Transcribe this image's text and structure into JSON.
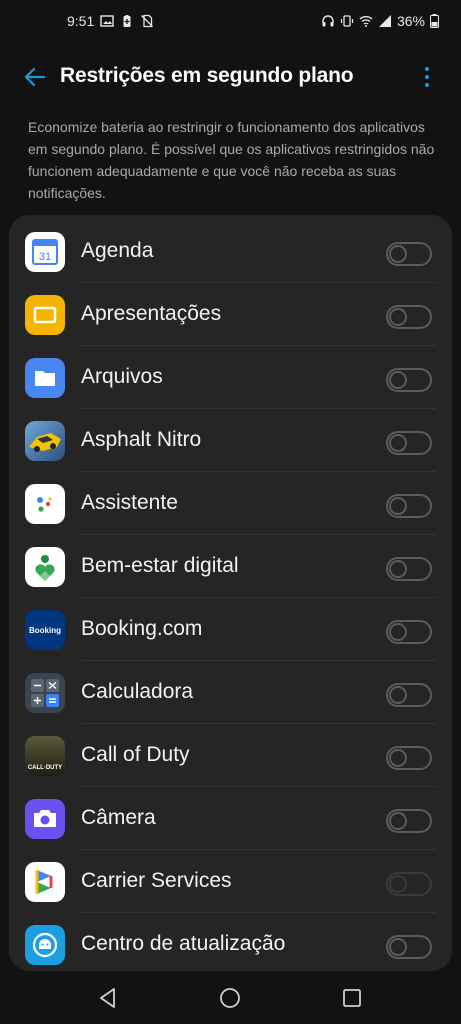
{
  "status_bar": {
    "time": "9:51",
    "battery_percent": "36%",
    "left_icons": [
      "gallery-icon",
      "battery-saver-icon",
      "no-sim-icon"
    ],
    "right_icons": [
      "headset-icon",
      "vibrate-icon",
      "wifi-icon",
      "signal-icon",
      "battery-icon"
    ]
  },
  "header": {
    "title": "Restrições em segundo plano",
    "back_icon": "arrow-back-icon",
    "menu_icon": "more-vert-icon",
    "accent_color": "#1a9bd6"
  },
  "description": "Economize bateria ao restringir o funcionamento dos aplicativos em segundo plano. É possível que os aplicativos restringidos não funcionem adequadamente e que você não receba as suas notificações.",
  "apps": [
    {
      "name": "Agenda",
      "icon": "calendar-icon",
      "enabled": false,
      "disabled_toggle": false
    },
    {
      "name": "Apresentações",
      "icon": "slides-icon",
      "enabled": false,
      "disabled_toggle": false
    },
    {
      "name": "Arquivos",
      "icon": "files-icon",
      "enabled": false,
      "disabled_toggle": false
    },
    {
      "name": "Asphalt Nitro",
      "icon": "asphalt-nitro-icon",
      "enabled": false,
      "disabled_toggle": false
    },
    {
      "name": "Assistente",
      "icon": "assistant-icon",
      "enabled": false,
      "disabled_toggle": false
    },
    {
      "name": "Bem-estar digital",
      "icon": "digital-wellbeing-icon",
      "enabled": false,
      "disabled_toggle": false
    },
    {
      "name": "Booking.com",
      "icon": "booking-icon",
      "icon_text": "Booking",
      "enabled": false,
      "disabled_toggle": false
    },
    {
      "name": "Calculadora",
      "icon": "calculator-icon",
      "enabled": false,
      "disabled_toggle": false
    },
    {
      "name": "Call of Duty",
      "icon": "call-of-duty-icon",
      "icon_text": "CALL·DUTY",
      "enabled": false,
      "disabled_toggle": false
    },
    {
      "name": "Câmera",
      "icon": "camera-icon",
      "enabled": false,
      "disabled_toggle": false
    },
    {
      "name": "Carrier Services",
      "icon": "carrier-services-icon",
      "enabled": false,
      "disabled_toggle": true
    },
    {
      "name": "Centro de atualização",
      "icon": "update-center-icon",
      "enabled": false,
      "disabled_toggle": false
    }
  ],
  "nav_bar": {
    "icons": [
      "back-triangle-icon",
      "home-circle-icon",
      "recents-square-icon"
    ]
  }
}
